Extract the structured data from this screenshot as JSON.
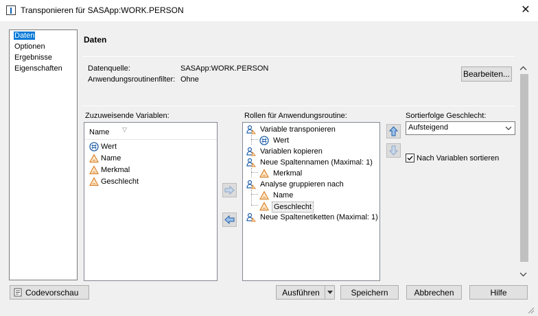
{
  "window": {
    "title": "Transponieren für SASApp:WORK.PERSON",
    "close": "✕"
  },
  "nav": {
    "items": [
      {
        "label": "Daten",
        "selected": true
      },
      {
        "label": "Optionen",
        "selected": false
      },
      {
        "label": "Ergebnisse",
        "selected": false
      },
      {
        "label": "Eigenschaften",
        "selected": false
      }
    ]
  },
  "section": {
    "heading": "Daten"
  },
  "source": {
    "datasource_label": "Datenquelle:",
    "datasource_value": "SASApp:WORK.PERSON",
    "filter_label": "Anwendungsroutinenfilter:",
    "filter_value": "Ohne",
    "edit_button": "Bearbeiten..."
  },
  "variables": {
    "label": "Zuzuweisende Variablen:",
    "column_header": "Name",
    "sort_indicator": "▽",
    "items": [
      {
        "name": "Wert",
        "type": "numeric-icon"
      },
      {
        "name": "Name",
        "type": "character-icon"
      },
      {
        "name": "Merkmal",
        "type": "character-icon"
      },
      {
        "name": "Geschlecht",
        "type": "character-icon"
      }
    ]
  },
  "roles": {
    "label": "Rollen für Anwendungsroutine:",
    "groups": [
      {
        "role": "Variable transponieren",
        "children": [
          {
            "name": "Wert",
            "type": "numeric-icon"
          }
        ]
      },
      {
        "role": "Variablen kopieren",
        "children": []
      },
      {
        "role": "Neue Spaltennamen  (Maximal: 1)",
        "children": [
          {
            "name": "Merkmal",
            "type": "character-icon"
          }
        ]
      },
      {
        "role": "Analyse gruppieren nach",
        "children": [
          {
            "name": "Name",
            "type": "character-icon"
          },
          {
            "name": "Geschlecht",
            "type": "character-icon"
          }
        ]
      },
      {
        "role": "Neue Spaltenetiketten  (Maximal: 1)",
        "children": []
      }
    ]
  },
  "sort": {
    "label": "Sortierfolge Geschlecht:",
    "selected": "Aufsteigend",
    "checkbox_label": "Nach Variablen sortieren",
    "checkbox_checked": true
  },
  "footer": {
    "preview_button": "Codevorschau",
    "run_button": "Ausführen",
    "save_button": "Speichern",
    "cancel_button": "Abbrechen",
    "help_button": "Hilfe"
  },
  "colors": {
    "accent": "#0078d7",
    "role_icon": "#1f5fa8",
    "char_icon": "#d9822b",
    "num_icon": "#1f5fa8"
  }
}
